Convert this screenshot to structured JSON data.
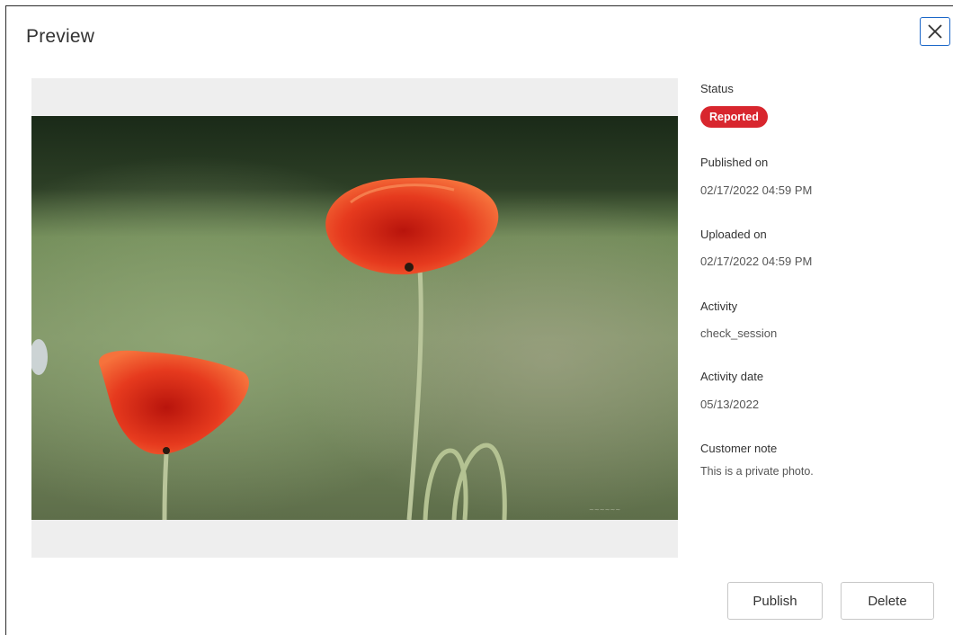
{
  "dialog": {
    "title": "Preview",
    "close_icon": "close-icon"
  },
  "pager": {
    "prev_icon": "chevron-left-icon",
    "next_icon": "chevron-right-icon"
  },
  "details": {
    "status_label": "Status",
    "status_value": "Reported",
    "published_label": "Published on",
    "published_value": "02/17/2022 04:59 PM",
    "uploaded_label": "Uploaded on",
    "uploaded_value": "02/17/2022 04:59 PM",
    "activity_label": "Activity",
    "activity_value": "check_session",
    "activity_date_label": "Activity date",
    "activity_date_value": "05/13/2022",
    "note_label": "Customer note",
    "note_value": "This is a private photo."
  },
  "actions": {
    "publish_label": "Publish",
    "delete_label": "Delete"
  },
  "colors": {
    "status_badge": "#d8262e",
    "pager": "#1a73d9",
    "close_border": "#1a66c8"
  }
}
